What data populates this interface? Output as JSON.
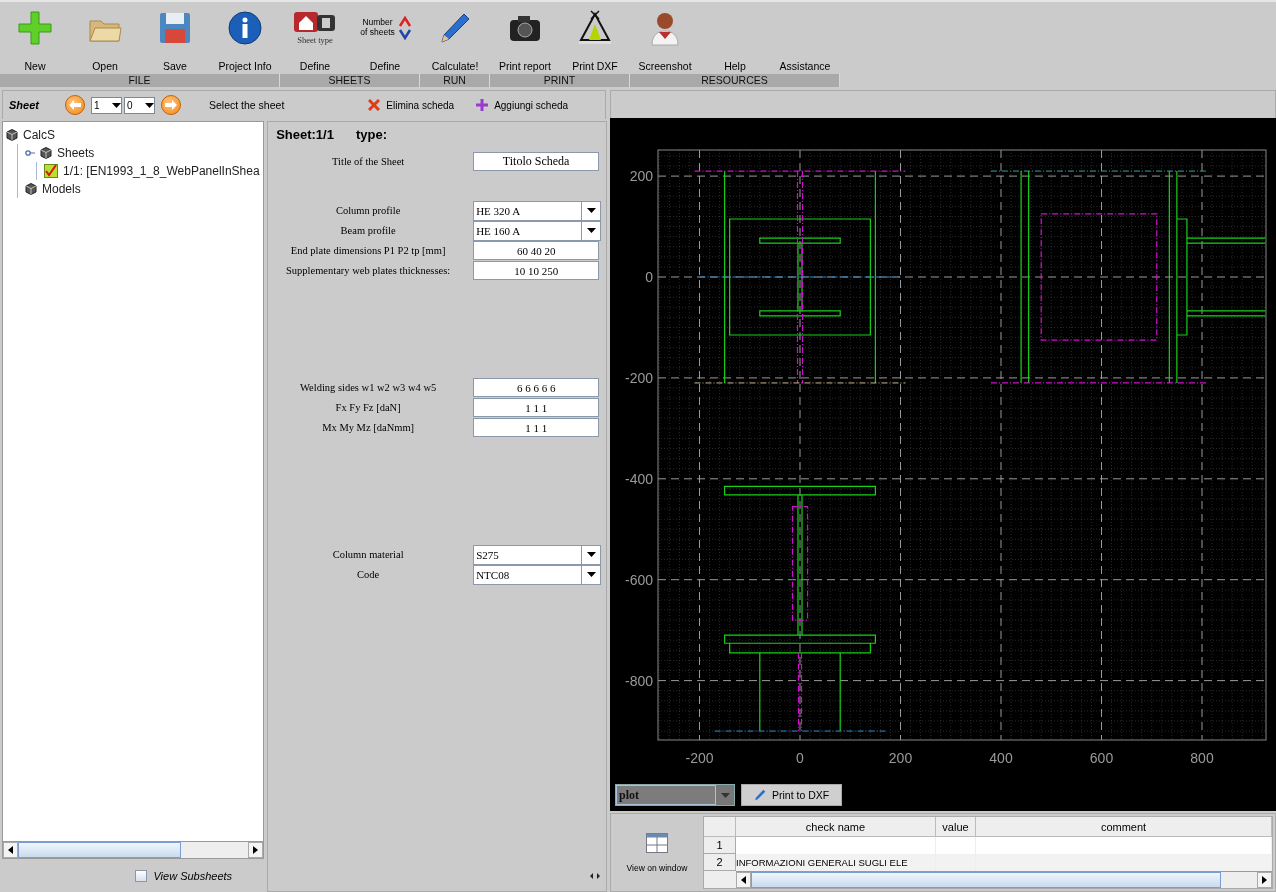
{
  "toolbar": {
    "groups": [
      {
        "label": "FILE",
        "buttons": [
          {
            "label": "New"
          },
          {
            "label": "Open"
          },
          {
            "label": "Save"
          },
          {
            "label": "Project Info"
          }
        ]
      },
      {
        "label": "SHEETS",
        "buttons": [
          {
            "label": "Define",
            "icon_caption": "Sheet type"
          },
          {
            "label": "Define",
            "icon_caption": "Number of sheets"
          }
        ]
      },
      {
        "label": "RUN",
        "buttons": [
          {
            "label": "Calculate!"
          }
        ]
      },
      {
        "label": "PRINT",
        "buttons": [
          {
            "label": "Print report"
          },
          {
            "label": "Print DXF"
          }
        ]
      },
      {
        "label": "RESOURCES",
        "buttons": [
          {
            "label": "Screenshot"
          },
          {
            "label": "Help"
          },
          {
            "label": "Assistance"
          }
        ]
      }
    ]
  },
  "sheet_bar": {
    "title": "Sheet",
    "spinners": [
      "1",
      "0"
    ],
    "hint": "Select the sheet",
    "actions": [
      {
        "kind": "remove",
        "label": "Elimina scheda"
      },
      {
        "kind": "add",
        "label": "Aggiungi scheda"
      }
    ]
  },
  "tree": [
    {
      "label": "CalcS",
      "children": [
        {
          "label": "Sheets",
          "expanded": true,
          "children": [
            {
              "label": "1/1: [EN1993_1_8_WebPanelInShea",
              "checked": true
            }
          ]
        },
        {
          "label": "Models"
        }
      ]
    }
  ],
  "view_subsheets": {
    "label": "View Subsheets",
    "checked": false
  },
  "form": {
    "sheet": "Sheet:1/1",
    "type_label": "type:",
    "sections": [
      [
        {
          "kind": "text",
          "label": "Title of the Sheet",
          "value": "Titolo Scheda"
        }
      ],
      [
        {
          "kind": "select",
          "label": "Column profile",
          "value": "HE 320 A"
        },
        {
          "kind": "select",
          "label": "Beam profile",
          "value": "HE 160 A"
        },
        {
          "kind": "text",
          "label": "End plate dimensions P1 P2 tp [mm]",
          "value": "60 40 20"
        },
        {
          "kind": "text",
          "label": "Supplementary web plates thicknesses:",
          "value": "10 10 250"
        }
      ],
      [
        {
          "kind": "text",
          "label": "Welding sides w1 w2 w3 w4 w5",
          "value": "6 6 6 6 6"
        },
        {
          "kind": "text",
          "label": "Fx Fy Fz [daN]",
          "value": "1 1 1"
        },
        {
          "kind": "text",
          "label": "Mx My Mz [daNmm]",
          "value": "1 1 1"
        }
      ],
      [
        {
          "kind": "select",
          "label": "Column material",
          "value": "S275"
        },
        {
          "kind": "select",
          "label": "Code",
          "value": "NTC08"
        }
      ]
    ]
  },
  "plot": {
    "x_ticks": [
      "-200",
      "0",
      "200",
      "400",
      "600",
      "800"
    ],
    "y_ticks": [
      "200",
      "0",
      "-200",
      "-400",
      "-600",
      "-800"
    ],
    "view": "plot",
    "print_button": "Print to DXF"
  },
  "checks": {
    "view_button": "View on window",
    "columns": [
      "check name",
      "value",
      "comment"
    ],
    "rows": [
      {
        "number": "1"
      },
      {
        "number": "2",
        "check_name": "INFORMAZIONI GENERALI SUGLI ELE"
      }
    ]
  }
}
